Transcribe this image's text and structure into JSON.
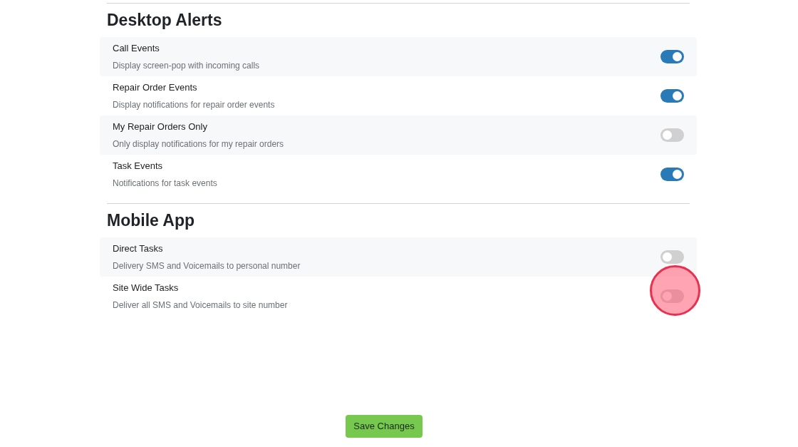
{
  "sections": [
    {
      "title": "Desktop Alerts",
      "items": [
        {
          "label": "Call Events",
          "description": "Display screen-pop with incoming calls",
          "on": true,
          "highlighted": false
        },
        {
          "label": "Repair Order Events",
          "description": "Display notifications for repair order events",
          "on": true,
          "highlighted": false
        },
        {
          "label": "My Repair Orders Only",
          "description": "Only display notifications for my repair orders",
          "on": false,
          "highlighted": false
        },
        {
          "label": "Task Events",
          "description": "Notifications for task events",
          "on": true,
          "highlighted": false
        }
      ]
    },
    {
      "title": "Mobile App",
      "items": [
        {
          "label": "Direct Tasks",
          "description": "Delivery SMS and Voicemails to personal number",
          "on": false,
          "highlighted": false
        },
        {
          "label": "Site Wide Tasks",
          "description": "Deliver all SMS and Voicemails to site number",
          "on": false,
          "highlighted": true
        }
      ]
    }
  ],
  "save_button": "Save Changes"
}
